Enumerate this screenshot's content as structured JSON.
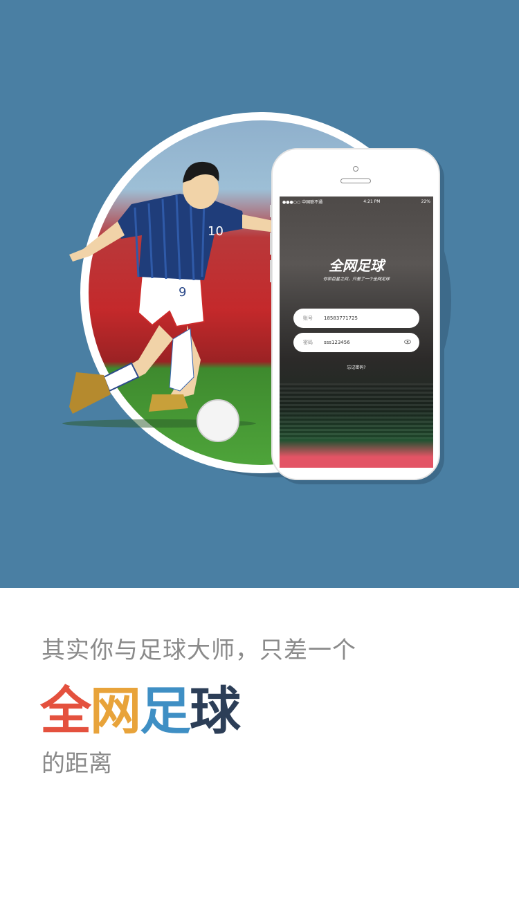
{
  "colors": {
    "hero_background": "#4a7fa3",
    "brand_char_1": "#e4513e",
    "brand_char_2": "#e8a33a",
    "brand_char_3": "#3f8fc4",
    "brand_char_4": "#2c3e57",
    "tagline_text": "#8a8a8a"
  },
  "phone": {
    "status_carrier": "●●●○○ 中国联不通",
    "status_time": "4:21 PM",
    "status_battery": "22%",
    "app_title": "全网足球",
    "app_subtitle": "你和巨星之间，只差了一个全网足球",
    "account_label": "账号",
    "account_value": "18583771725",
    "password_label": "密码",
    "password_value": "sss123456",
    "forgot_link": "忘记密码?"
  },
  "tagline": {
    "line1": "其实你与足球大师，只差一个",
    "brand": [
      "全",
      "网",
      "足",
      "球"
    ],
    "line3": "的距离"
  },
  "icons": [
    "eye-icon",
    "soccer-ball-icon"
  ]
}
